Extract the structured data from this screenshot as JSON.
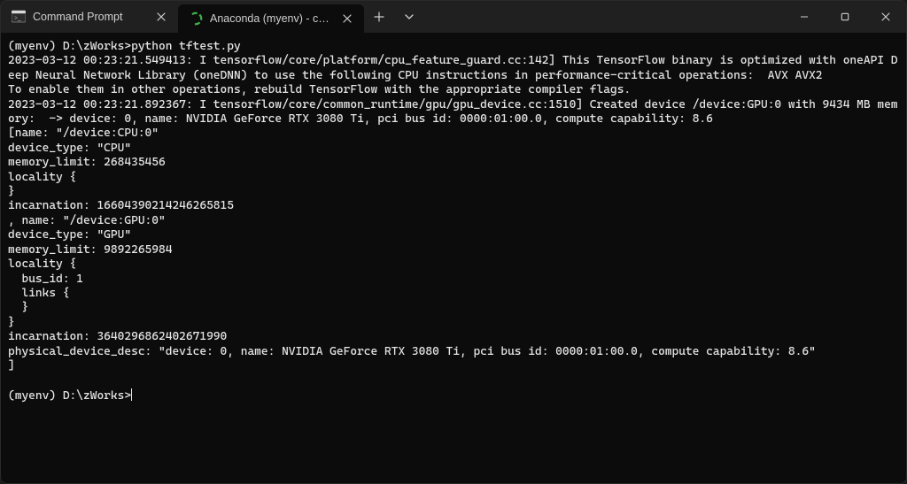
{
  "tabs": [
    {
      "label": "Command Prompt",
      "active": false,
      "iconType": "cmd"
    },
    {
      "label": "Anaconda (myenv) - conda",
      "active": true,
      "iconType": "conda"
    }
  ],
  "newTabTooltip": "New tab",
  "dropdownTooltip": "New tab dropdown",
  "winControls": {
    "minimize": "Minimize",
    "maximize": "Maximize",
    "close": "Close"
  },
  "terminal": {
    "promptLine1": "(myenv) D:\\zWorks>python tftest.py",
    "lines": [
      "2023-03-12 00:23:21.549413: I tensorflow/core/platform/cpu_feature_guard.cc:142] This TensorFlow binary is optimized with oneAPI Deep Neural Network Library (oneDNN) to use the following CPU instructions in performance-critical operations:  AVX AVX2",
      "To enable them in other operations, rebuild TensorFlow with the appropriate compiler flags.",
      "2023-03-12 00:23:21.892367: I tensorflow/core/common_runtime/gpu/gpu_device.cc:1510] Created device /device:GPU:0 with 9434 MB memory:  -> device: 0, name: NVIDIA GeForce RTX 3080 Ti, pci bus id: 0000:01:00.0, compute capability: 8.6",
      "[name: \"/device:CPU:0\"",
      "device_type: \"CPU\"",
      "memory_limit: 268435456",
      "locality {",
      "}",
      "incarnation: 16604390214246265815",
      ", name: \"/device:GPU:0\"",
      "device_type: \"GPU\"",
      "memory_limit: 9892265984",
      "locality {",
      "  bus_id: 1",
      "  links {",
      "  }",
      "}",
      "incarnation: 3640296862402671990",
      "physical_device_desc: \"device: 0, name: NVIDIA GeForce RTX 3080 Ti, pci bus id: 0000:01:00.0, compute capability: 8.6\"",
      "]",
      ""
    ],
    "promptLine2": "(myenv) D:\\zWorks>"
  }
}
